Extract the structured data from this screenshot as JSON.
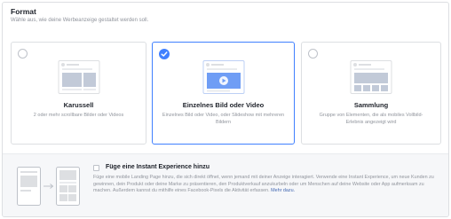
{
  "format": {
    "title": "Format",
    "subtitle": "Wähle aus, wie deine Werbeanzeige gestaltet werden soll."
  },
  "cards": [
    {
      "label": "Karussell",
      "description": "2 oder mehr scrollbare Bilder oder Videos",
      "selected": false
    },
    {
      "label": "Einzelnes Bild oder Video",
      "description": "Einzelnes Bild oder Video, oder Slideshow mit mehreren Bildern",
      "selected": true
    },
    {
      "label": "Sammlung",
      "description": "Gruppe von Elementen, die als mobiles Vollbild-Erlebnis angezeigt wird",
      "selected": false
    }
  ],
  "instant_experience": {
    "title": "Füge eine Instant Experience hinzu",
    "description": "Füge eine mobile Landing Page hinzu, die sich direkt öffnet, wenn jemand mit deiner Anzeige interagiert. Verwende eine Instant Experience, um neue Kunden zu gewinnen, dein Produkt oder deine Marke zu präsentieren, den Produktverkauf anzukurbeln oder um Menschen auf deine Website oder App aufmerksam zu machen. Außerdem kannst du mithilfe eines Facebook-Pixels die Aktivität erfassen.",
    "link": "Mehr dazu."
  },
  "colors": {
    "accent": "#4080ff",
    "border": "#dddfe2",
    "muted_text": "#90949c",
    "link": "#4267b2"
  }
}
